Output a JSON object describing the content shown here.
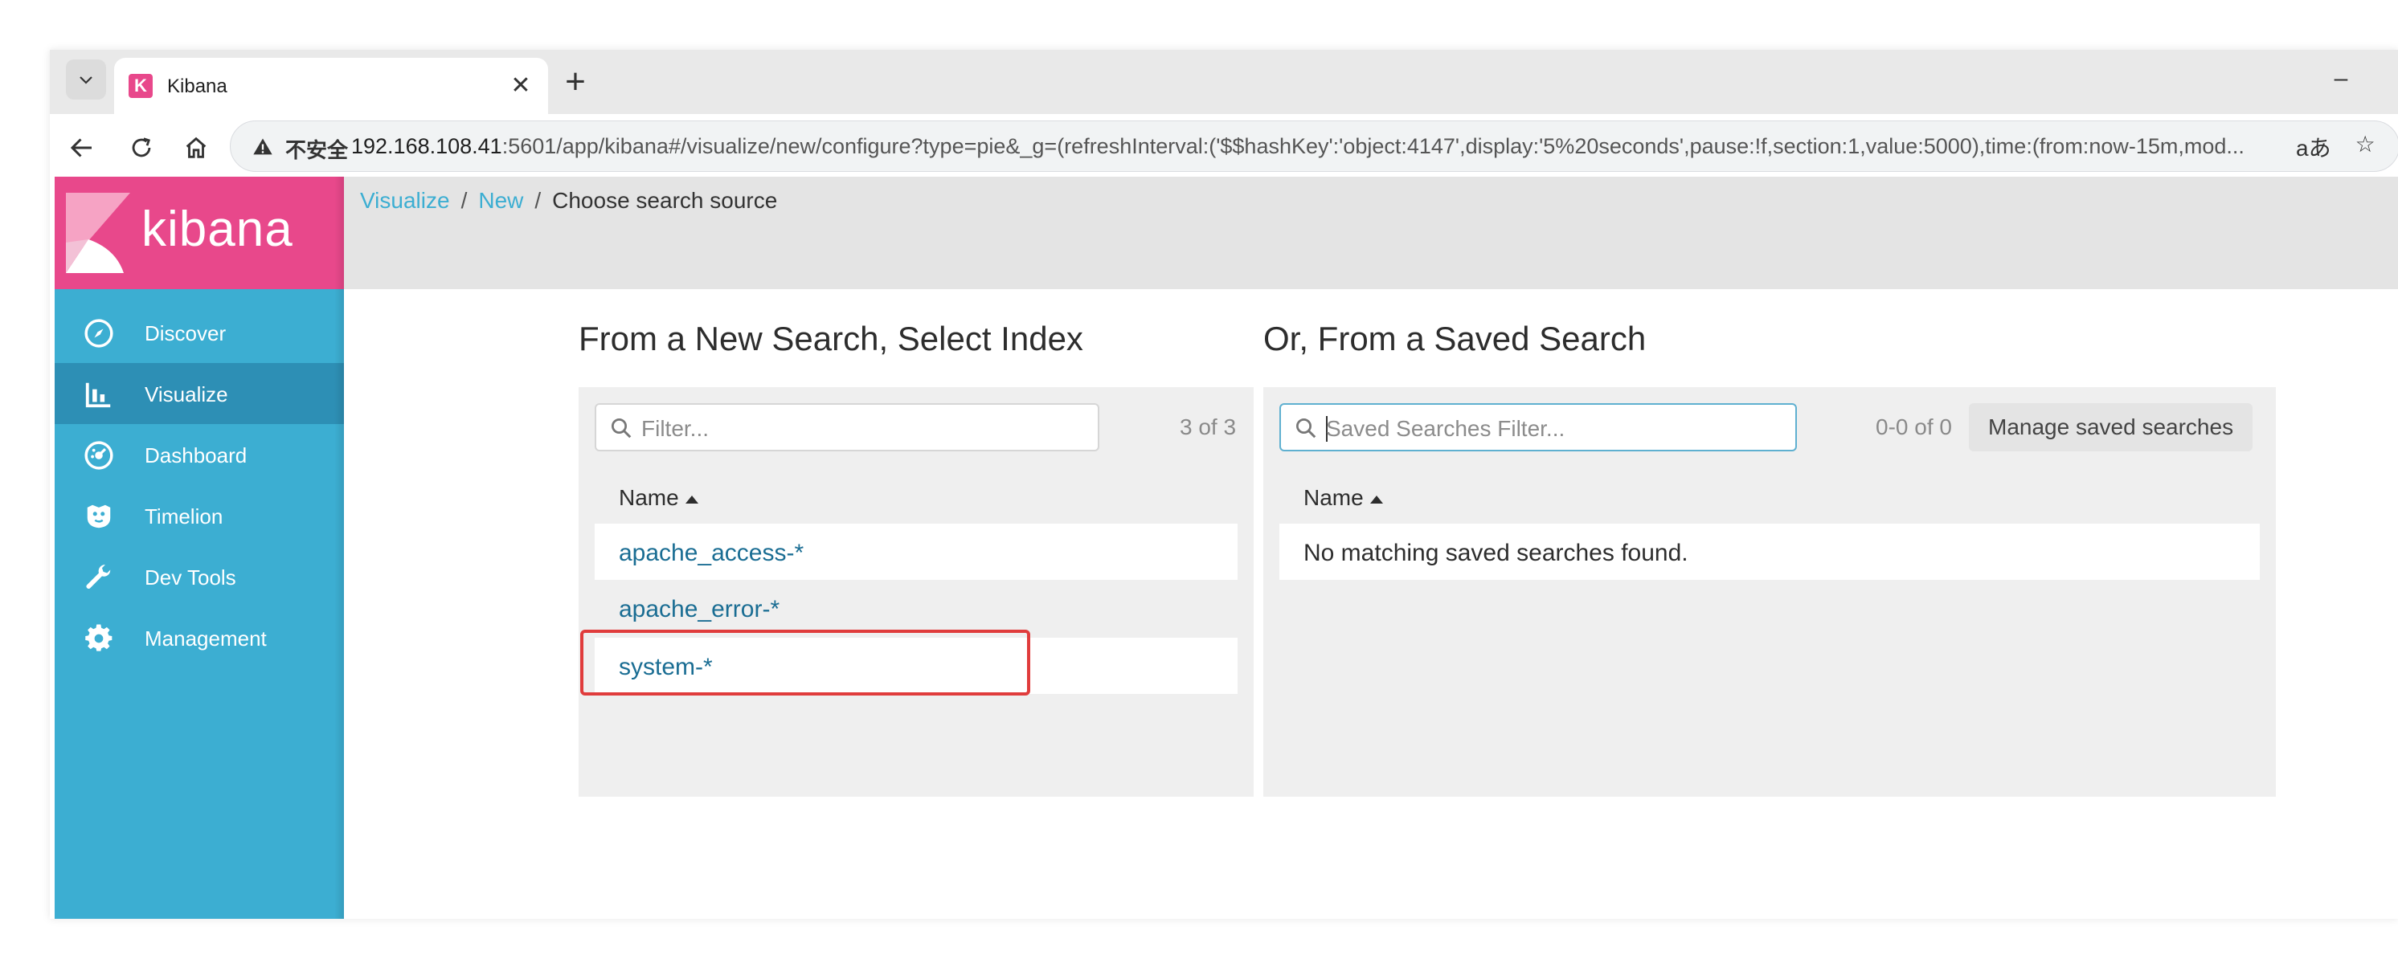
{
  "browser": {
    "tab_title": "Kibana",
    "favicon_letter": "K",
    "close_glyph": "✕",
    "new_tab_glyph": "+",
    "minimize_glyph": "–",
    "insecure_label": "不安全",
    "url_host": "192.168.108.41",
    "url_rest": ":5601/app/kibana#/visualize/new/configure?type=pie&_g=(refreshInterval:('$$hashKey':'object:4147',display:'5%20seconds',pause:!f,section:1,value:5000),time:(from:now-15m,mod...",
    "translate_glyph": "aあ",
    "star_glyph": "☆"
  },
  "sidebar": {
    "logo_text": "kibana",
    "items": [
      {
        "label": "Discover",
        "icon": "compass-icon"
      },
      {
        "label": "Visualize",
        "icon": "bar-chart-icon"
      },
      {
        "label": "Dashboard",
        "icon": "dashboard-icon"
      },
      {
        "label": "Timelion",
        "icon": "timelion-icon"
      },
      {
        "label": "Dev Tools",
        "icon": "wrench-icon"
      },
      {
        "label": "Management",
        "icon": "gear-icon"
      }
    ],
    "active_index": 1
  },
  "breadcrumb": {
    "items": [
      "Visualize",
      "New",
      "Choose search source"
    ],
    "sep": "/"
  },
  "new_search": {
    "title": "From a New Search, Select Index",
    "filter_placeholder": "Filter...",
    "count": "3 of 3",
    "column": "Name",
    "indices": [
      "apache_access-*",
      "apache_error-*",
      "system-*"
    ]
  },
  "saved_search": {
    "title": "Or, From a Saved Search",
    "filter_placeholder": "Saved Searches Filter...",
    "count": "0-0 of 0",
    "manage_label": "Manage saved searches",
    "column": "Name",
    "empty_message": "No matching saved searches found."
  },
  "colors": {
    "kibana_pink": "#e8488b",
    "sidebar_blue": "#3caed2",
    "active_blue": "#2d8fb5",
    "link_blue": "#1a6d93",
    "highlight_red": "#e03c3c"
  }
}
